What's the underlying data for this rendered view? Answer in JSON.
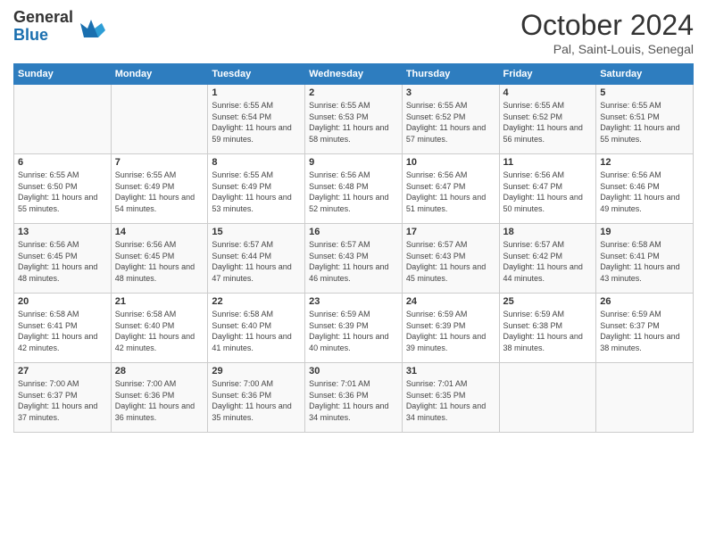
{
  "logo": {
    "general": "General",
    "blue": "Blue"
  },
  "title": "October 2024",
  "subtitle": "Pal, Saint-Louis, Senegal",
  "headers": [
    "Sunday",
    "Monday",
    "Tuesday",
    "Wednesday",
    "Thursday",
    "Friday",
    "Saturday"
  ],
  "weeks": [
    [
      {
        "day": "",
        "sunrise": "",
        "sunset": "",
        "daylight": ""
      },
      {
        "day": "",
        "sunrise": "",
        "sunset": "",
        "daylight": ""
      },
      {
        "day": "1",
        "sunrise": "Sunrise: 6:55 AM",
        "sunset": "Sunset: 6:54 PM",
        "daylight": "Daylight: 11 hours and 59 minutes."
      },
      {
        "day": "2",
        "sunrise": "Sunrise: 6:55 AM",
        "sunset": "Sunset: 6:53 PM",
        "daylight": "Daylight: 11 hours and 58 minutes."
      },
      {
        "day": "3",
        "sunrise": "Sunrise: 6:55 AM",
        "sunset": "Sunset: 6:52 PM",
        "daylight": "Daylight: 11 hours and 57 minutes."
      },
      {
        "day": "4",
        "sunrise": "Sunrise: 6:55 AM",
        "sunset": "Sunset: 6:52 PM",
        "daylight": "Daylight: 11 hours and 56 minutes."
      },
      {
        "day": "5",
        "sunrise": "Sunrise: 6:55 AM",
        "sunset": "Sunset: 6:51 PM",
        "daylight": "Daylight: 11 hours and 55 minutes."
      }
    ],
    [
      {
        "day": "6",
        "sunrise": "Sunrise: 6:55 AM",
        "sunset": "Sunset: 6:50 PM",
        "daylight": "Daylight: 11 hours and 55 minutes."
      },
      {
        "day": "7",
        "sunrise": "Sunrise: 6:55 AM",
        "sunset": "Sunset: 6:49 PM",
        "daylight": "Daylight: 11 hours and 54 minutes."
      },
      {
        "day": "8",
        "sunrise": "Sunrise: 6:55 AM",
        "sunset": "Sunset: 6:49 PM",
        "daylight": "Daylight: 11 hours and 53 minutes."
      },
      {
        "day": "9",
        "sunrise": "Sunrise: 6:56 AM",
        "sunset": "Sunset: 6:48 PM",
        "daylight": "Daylight: 11 hours and 52 minutes."
      },
      {
        "day": "10",
        "sunrise": "Sunrise: 6:56 AM",
        "sunset": "Sunset: 6:47 PM",
        "daylight": "Daylight: 11 hours and 51 minutes."
      },
      {
        "day": "11",
        "sunrise": "Sunrise: 6:56 AM",
        "sunset": "Sunset: 6:47 PM",
        "daylight": "Daylight: 11 hours and 50 minutes."
      },
      {
        "day": "12",
        "sunrise": "Sunrise: 6:56 AM",
        "sunset": "Sunset: 6:46 PM",
        "daylight": "Daylight: 11 hours and 49 minutes."
      }
    ],
    [
      {
        "day": "13",
        "sunrise": "Sunrise: 6:56 AM",
        "sunset": "Sunset: 6:45 PM",
        "daylight": "Daylight: 11 hours and 48 minutes."
      },
      {
        "day": "14",
        "sunrise": "Sunrise: 6:56 AM",
        "sunset": "Sunset: 6:45 PM",
        "daylight": "Daylight: 11 hours and 48 minutes."
      },
      {
        "day": "15",
        "sunrise": "Sunrise: 6:57 AM",
        "sunset": "Sunset: 6:44 PM",
        "daylight": "Daylight: 11 hours and 47 minutes."
      },
      {
        "day": "16",
        "sunrise": "Sunrise: 6:57 AM",
        "sunset": "Sunset: 6:43 PM",
        "daylight": "Daylight: 11 hours and 46 minutes."
      },
      {
        "day": "17",
        "sunrise": "Sunrise: 6:57 AM",
        "sunset": "Sunset: 6:43 PM",
        "daylight": "Daylight: 11 hours and 45 minutes."
      },
      {
        "day": "18",
        "sunrise": "Sunrise: 6:57 AM",
        "sunset": "Sunset: 6:42 PM",
        "daylight": "Daylight: 11 hours and 44 minutes."
      },
      {
        "day": "19",
        "sunrise": "Sunrise: 6:58 AM",
        "sunset": "Sunset: 6:41 PM",
        "daylight": "Daylight: 11 hours and 43 minutes."
      }
    ],
    [
      {
        "day": "20",
        "sunrise": "Sunrise: 6:58 AM",
        "sunset": "Sunset: 6:41 PM",
        "daylight": "Daylight: 11 hours and 42 minutes."
      },
      {
        "day": "21",
        "sunrise": "Sunrise: 6:58 AM",
        "sunset": "Sunset: 6:40 PM",
        "daylight": "Daylight: 11 hours and 42 minutes."
      },
      {
        "day": "22",
        "sunrise": "Sunrise: 6:58 AM",
        "sunset": "Sunset: 6:40 PM",
        "daylight": "Daylight: 11 hours and 41 minutes."
      },
      {
        "day": "23",
        "sunrise": "Sunrise: 6:59 AM",
        "sunset": "Sunset: 6:39 PM",
        "daylight": "Daylight: 11 hours and 40 minutes."
      },
      {
        "day": "24",
        "sunrise": "Sunrise: 6:59 AM",
        "sunset": "Sunset: 6:39 PM",
        "daylight": "Daylight: 11 hours and 39 minutes."
      },
      {
        "day": "25",
        "sunrise": "Sunrise: 6:59 AM",
        "sunset": "Sunset: 6:38 PM",
        "daylight": "Daylight: 11 hours and 38 minutes."
      },
      {
        "day": "26",
        "sunrise": "Sunrise: 6:59 AM",
        "sunset": "Sunset: 6:37 PM",
        "daylight": "Daylight: 11 hours and 38 minutes."
      }
    ],
    [
      {
        "day": "27",
        "sunrise": "Sunrise: 7:00 AM",
        "sunset": "Sunset: 6:37 PM",
        "daylight": "Daylight: 11 hours and 37 minutes."
      },
      {
        "day": "28",
        "sunrise": "Sunrise: 7:00 AM",
        "sunset": "Sunset: 6:36 PM",
        "daylight": "Daylight: 11 hours and 36 minutes."
      },
      {
        "day": "29",
        "sunrise": "Sunrise: 7:00 AM",
        "sunset": "Sunset: 6:36 PM",
        "daylight": "Daylight: 11 hours and 35 minutes."
      },
      {
        "day": "30",
        "sunrise": "Sunrise: 7:01 AM",
        "sunset": "Sunset: 6:36 PM",
        "daylight": "Daylight: 11 hours and 34 minutes."
      },
      {
        "day": "31",
        "sunrise": "Sunrise: 7:01 AM",
        "sunset": "Sunset: 6:35 PM",
        "daylight": "Daylight: 11 hours and 34 minutes."
      },
      {
        "day": "",
        "sunrise": "",
        "sunset": "",
        "daylight": ""
      },
      {
        "day": "",
        "sunrise": "",
        "sunset": "",
        "daylight": ""
      }
    ]
  ]
}
